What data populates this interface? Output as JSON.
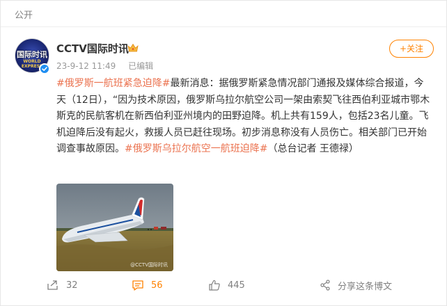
{
  "visibility": {
    "label": "公开"
  },
  "author": {
    "name": "CCTV国际时讯",
    "avatar_text": "国际时讯",
    "avatar_subtext": "WORLD EXPRESS",
    "verified": true
  },
  "post": {
    "timestamp": "23-9-12 11:49",
    "edited_label": "已编辑",
    "text_segments": [
      {
        "type": "hashtag",
        "text": "#俄罗斯一航班紧急迫降#"
      },
      {
        "type": "text",
        "text": "最新消息：据俄罗斯紧急情况部门通报及媒体综合报道，今天（12日），“因为技术原因，俄罗斯乌拉尔航空公司一架由索契飞往西伯利亚城市鄂木斯克的民航客机在新西伯利亚州境内的田野迫降。机上共有159人，包括23名儿童。飞机迫降后没有起火，救援人员已赶往现场。初步消息称没有人员伤亡。相关部门已开始调查事故原因。"
      },
      {
        "type": "hashtag",
        "text": "#俄罗斯乌拉尔航空一航班迫降#"
      },
      {
        "type": "text",
        "text": "（总台记者 王德禄）"
      }
    ],
    "image_watermark": "@CCTV国际时讯"
  },
  "follow_button": {
    "label": "+关注"
  },
  "actions": {
    "repost_count": "32",
    "comment_count": "56",
    "like_count": "445",
    "share_label": "分享这条博文"
  },
  "colors": {
    "accent": "#ff8200",
    "hashtag": "#eb7350",
    "verified": "#1f8ef1"
  }
}
